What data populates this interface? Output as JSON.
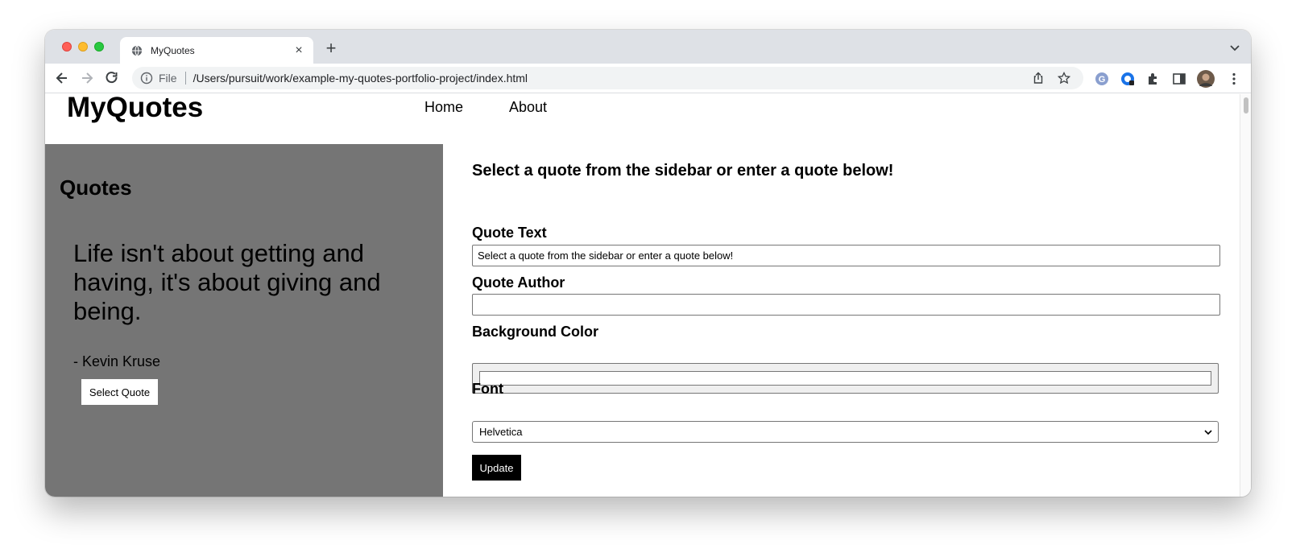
{
  "browser": {
    "tab_title": "MyQuotes",
    "new_tab_symbol": "+",
    "close_symbol": "×",
    "scheme_label": "File",
    "url": "/Users/pursuit/work/example-my-quotes-portfolio-project/index.html"
  },
  "site": {
    "logo": "MyQuotes",
    "nav": [
      "Home",
      "About"
    ]
  },
  "sidebar": {
    "heading": "Quotes",
    "quote_text": "Life isn't about getting and having, it's about giving and being.",
    "quote_author": "- Kevin Kruse",
    "select_button": "Select Quote",
    "background_color": "#757575"
  },
  "form": {
    "heading": "Select a quote from the sidebar or enter a quote below!",
    "quote_text_label": "Quote Text",
    "quote_text_value": "Select a quote from the sidebar or enter a quote below!",
    "quote_author_label": "Quote Author",
    "quote_author_value": "",
    "background_color_label": "Background Color",
    "background_color_value": "#ffffff",
    "font_label": "Font",
    "font_value": "Helvetica",
    "update_button": "Update"
  },
  "icons": {
    "tab": "globe-icon",
    "back": "back-arrow-icon",
    "forward": "forward-arrow-icon",
    "reload": "reload-icon",
    "info": "info-icon",
    "share": "share-icon",
    "bookmark": "star-icon",
    "extensions": "puzzle-icon",
    "side_panel": "side-panel-icon",
    "menu": "kebab-menu-icon"
  }
}
